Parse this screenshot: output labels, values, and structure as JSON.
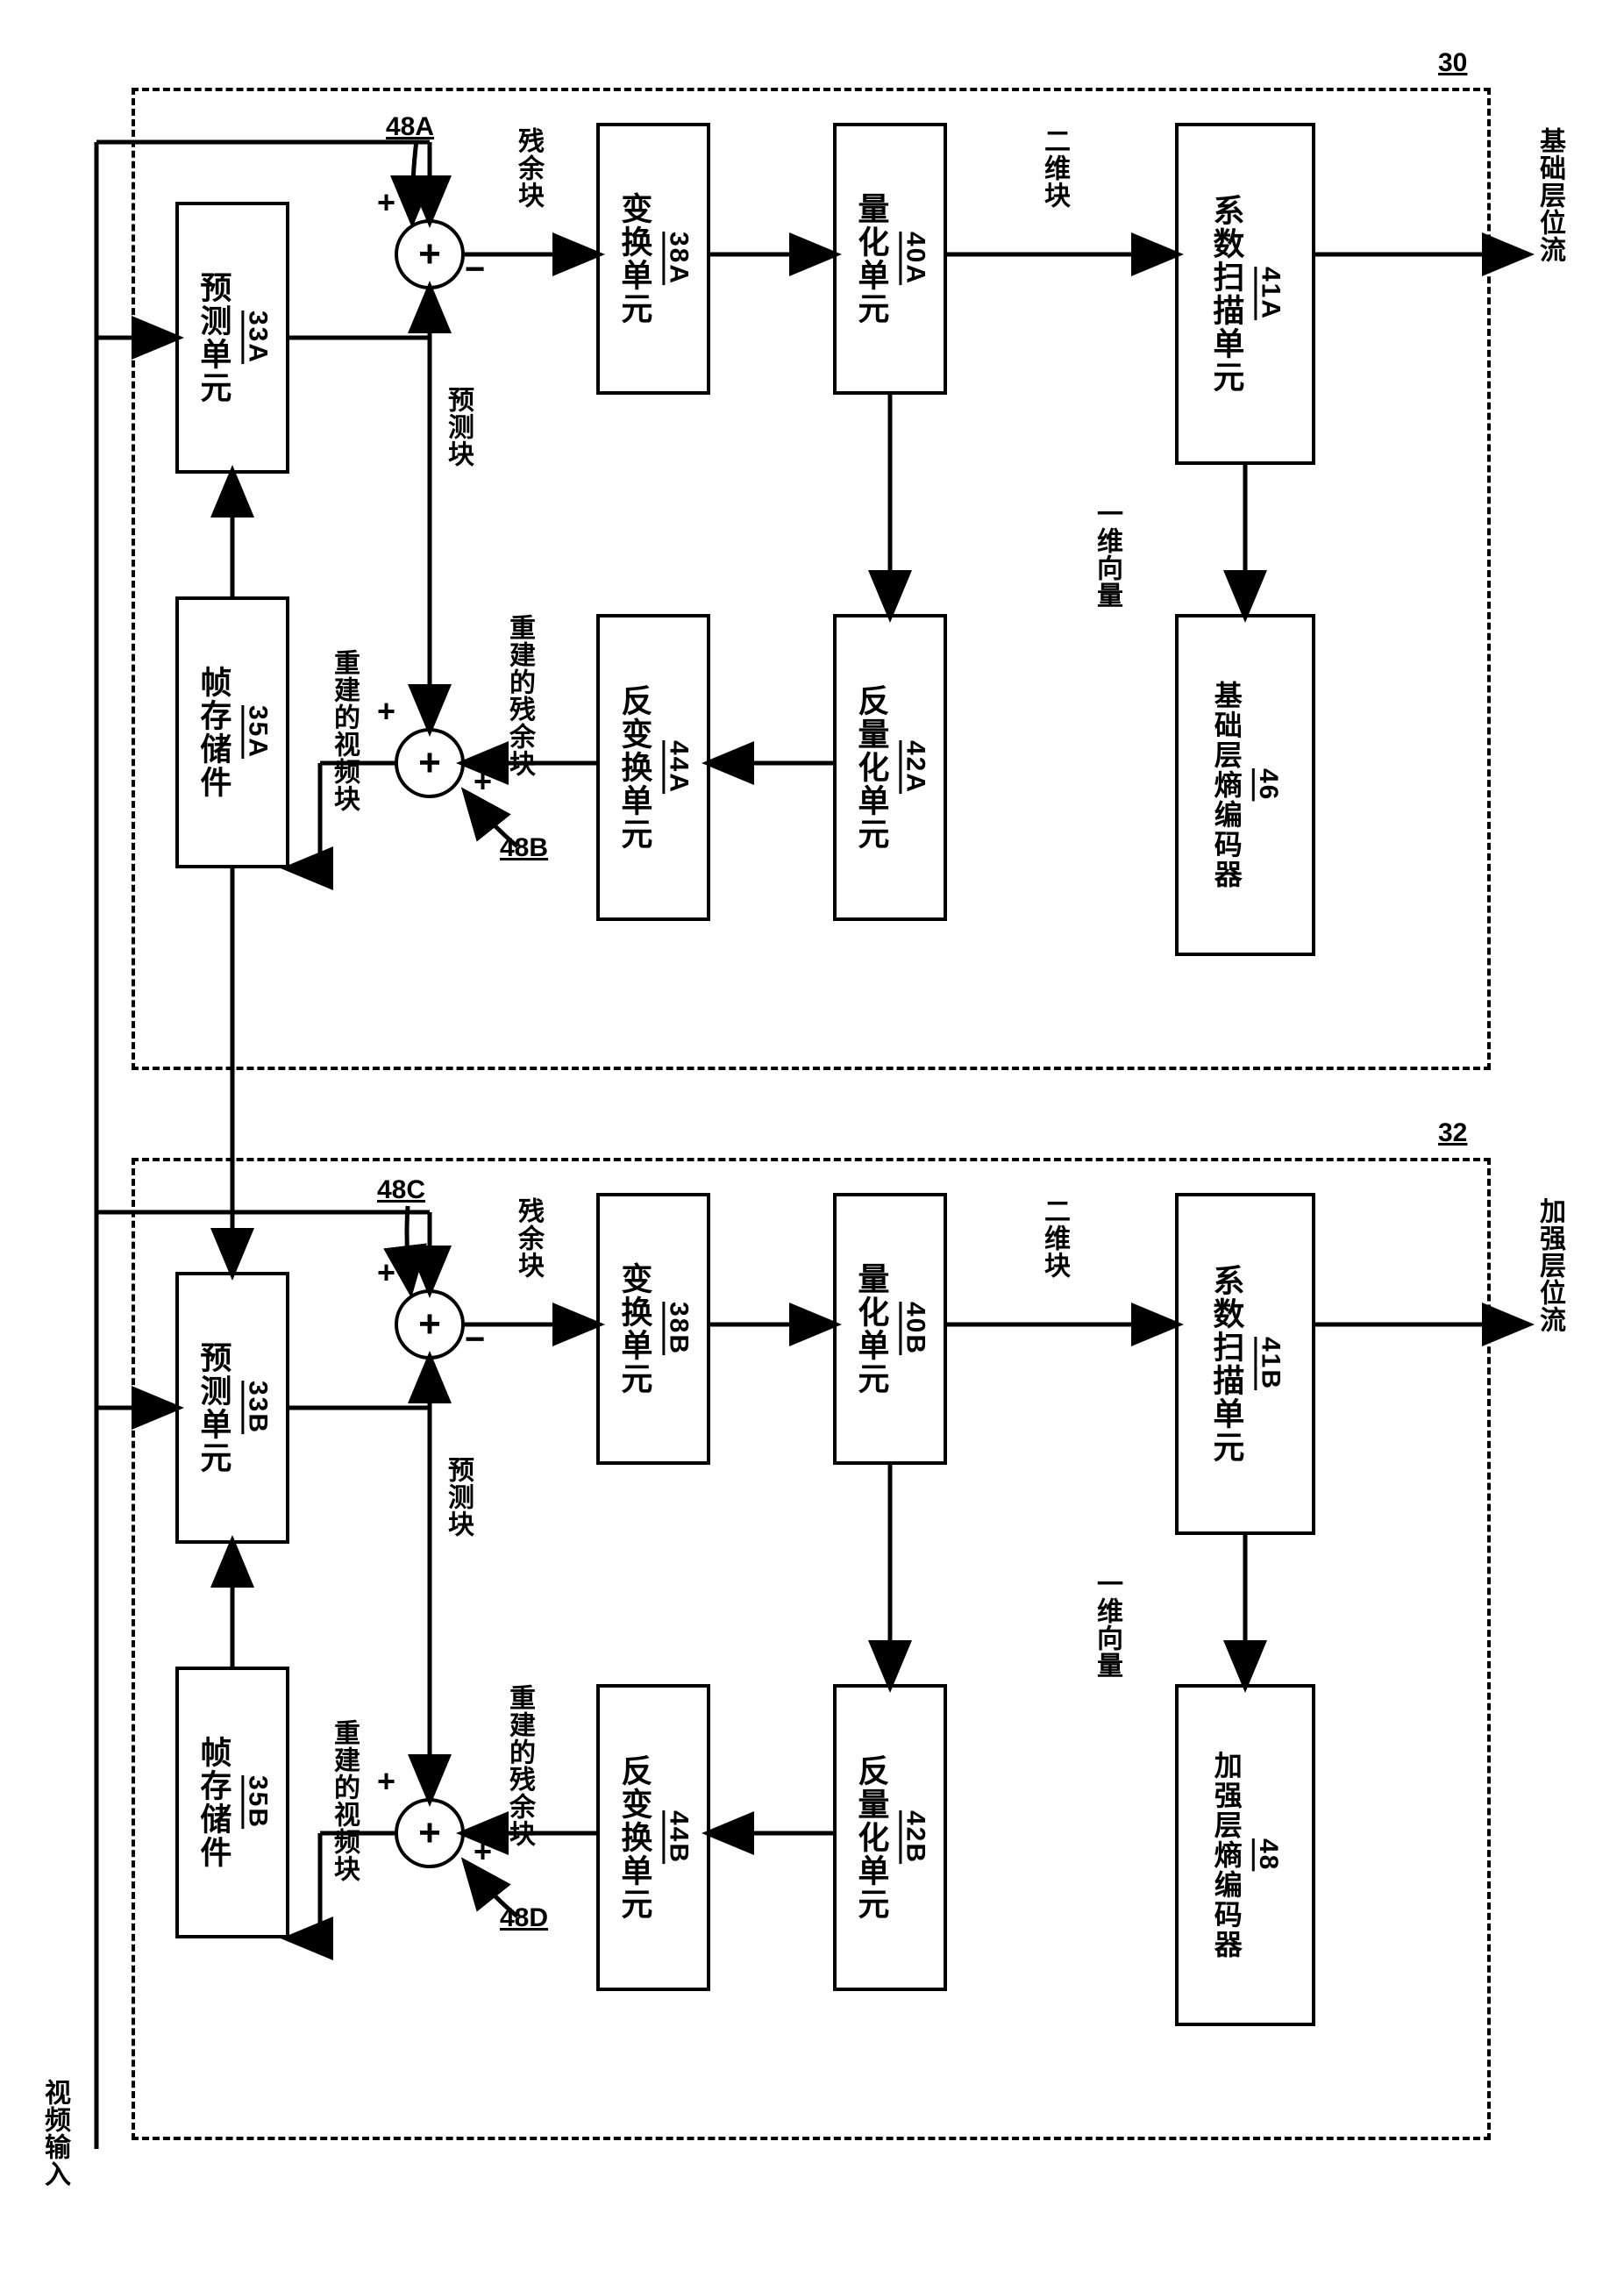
{
  "input_label": "视频输入",
  "top_ref": "30",
  "bottom_ref": "32",
  "blocks": {
    "predict_unit_a": "预测单元",
    "predict_unit_a_ref": "33A",
    "frame_store_a": "帧存储件",
    "frame_store_a_ref": "35A",
    "transform_a": "变换单元",
    "transform_a_ref": "38A",
    "quant_a": "量化单元",
    "quant_a_ref": "40A",
    "scan_a": "系数扫描单元",
    "scan_a_ref": "41A",
    "invquant_a": "反量化单元",
    "invquant_a_ref": "42A",
    "invtrans_a": "反变换单元",
    "invtrans_a_ref": "44A",
    "entropy_a": "基础层熵编码器",
    "entropy_a_ref": "46",
    "predict_unit_b": "预测单元",
    "predict_unit_b_ref": "33B",
    "frame_store_b": "帧存储件",
    "frame_store_b_ref": "35B",
    "transform_b": "变换单元",
    "transform_b_ref": "38B",
    "quant_b": "量化单元",
    "quant_b_ref": "40B",
    "scan_b": "系数扫描单元",
    "scan_b_ref": "41B",
    "invquant_b": "反量化单元",
    "invquant_b_ref": "42B",
    "invtrans_b": "反变换单元",
    "invtrans_b_ref": "44B",
    "entropy_b": "加强层熵编码器",
    "entropy_b_ref": "48"
  },
  "labels": {
    "residual": "残余块",
    "predict_block": "预测块",
    "recon_residual": "重建的残余块",
    "recon_video": "重建的视频块",
    "two_d": "二维块",
    "one_d": "一维向量",
    "base_out": "基础层位流",
    "enh_out": "加强层位流",
    "sum_48a": "48A",
    "sum_48b": "48B",
    "sum_48c": "48C",
    "sum_48d": "48D"
  }
}
